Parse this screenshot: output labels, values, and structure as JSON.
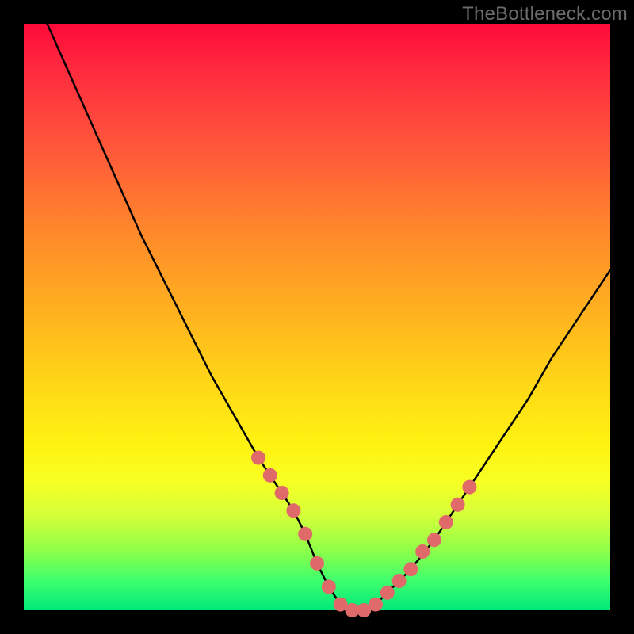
{
  "watermark": "TheBottleneck.com",
  "chart_data": {
    "type": "line",
    "title": "",
    "xlabel": "",
    "ylabel": "",
    "xlim": [
      0,
      100
    ],
    "ylim": [
      0,
      100
    ],
    "grid": false,
    "legend": false,
    "annotations": [],
    "series": [
      {
        "name": "bottleneck-curve",
        "color": "#000000",
        "x": [
          4,
          8,
          12,
          16,
          20,
          24,
          28,
          32,
          36,
          40,
          42,
          44,
          46,
          48,
          50,
          52,
          54,
          56,
          58,
          60,
          62,
          66,
          70,
          74,
          78,
          82,
          86,
          90,
          94,
          98,
          100
        ],
        "y": [
          100,
          91,
          82,
          73,
          64,
          56,
          48,
          40,
          33,
          26,
          23,
          20,
          17,
          13,
          8,
          4,
          1,
          0,
          0,
          1,
          3,
          7,
          12,
          18,
          24,
          30,
          36,
          43,
          49,
          55,
          58
        ]
      }
    ],
    "markers": [
      {
        "name": "curve-dots-left",
        "color": "#e06a6a",
        "shape": "circle",
        "points": [
          {
            "x": 40,
            "y": 26
          },
          {
            "x": 42,
            "y": 23
          },
          {
            "x": 44,
            "y": 20
          },
          {
            "x": 46,
            "y": 17
          },
          {
            "x": 48,
            "y": 13
          },
          {
            "x": 50,
            "y": 8
          },
          {
            "x": 52,
            "y": 4
          },
          {
            "x": 54,
            "y": 1
          },
          {
            "x": 56,
            "y": 0
          }
        ]
      },
      {
        "name": "curve-dots-right",
        "color": "#e06a6a",
        "shape": "circle",
        "points": [
          {
            "x": 58,
            "y": 0
          },
          {
            "x": 60,
            "y": 1
          },
          {
            "x": 62,
            "y": 3
          },
          {
            "x": 64,
            "y": 5
          },
          {
            "x": 66,
            "y": 7
          },
          {
            "x": 68,
            "y": 10
          },
          {
            "x": 70,
            "y": 12
          },
          {
            "x": 72,
            "y": 15
          },
          {
            "x": 74,
            "y": 18
          },
          {
            "x": 76,
            "y": 21
          }
        ]
      }
    ]
  }
}
